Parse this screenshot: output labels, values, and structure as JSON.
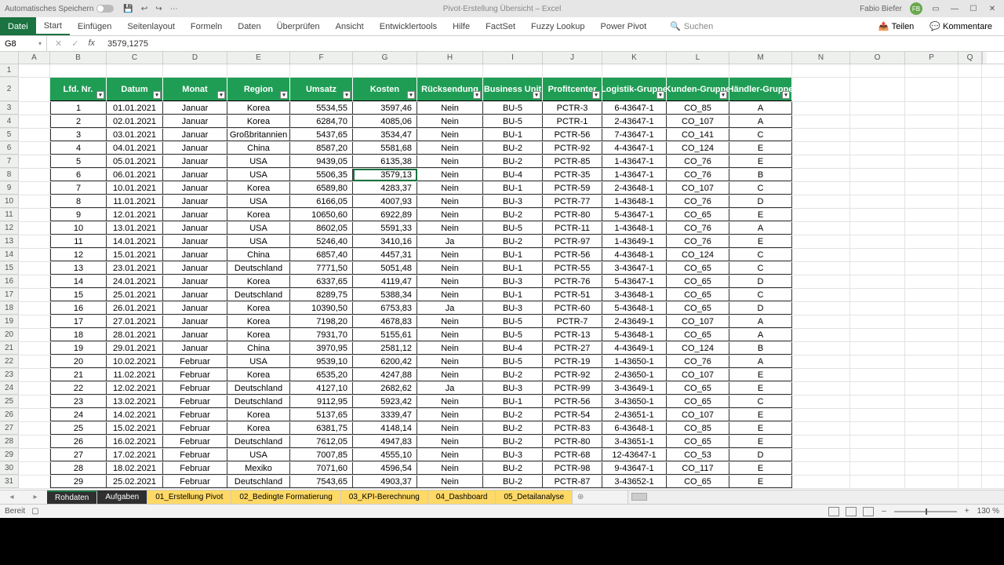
{
  "title": {
    "autosave": "Automatisches Speichern",
    "doc": "Pivot-Erstellung Übersicht",
    "app": "Excel",
    "user": "Fabio Biefer",
    "initials": "FB"
  },
  "ribbon_tabs": [
    "Datei",
    "Start",
    "Einfügen",
    "Seitenlayout",
    "Formeln",
    "Daten",
    "Überprüfen",
    "Ansicht",
    "Entwicklertools",
    "Hilfe",
    "FactSet",
    "Fuzzy Lookup",
    "Power Pivot"
  ],
  "search_placeholder": "Suchen",
  "share_label": "Teilen",
  "comments_label": "Kommentare",
  "namebox": "G8",
  "formula": "3579,1275",
  "columns": [
    "A",
    "B",
    "C",
    "D",
    "E",
    "F",
    "G",
    "H",
    "I",
    "J",
    "K",
    "L",
    "M",
    "N",
    "O",
    "P",
    "Q"
  ],
  "headers": [
    "Lfd. Nr.",
    "Datum",
    "Monat",
    "Region",
    "Umsatz",
    "Kosten",
    "Rücksendung",
    "Business Unit",
    "Profitcenter",
    "Logistik-Gruppe",
    "Kunden-Gruppe",
    "Händler-Gruppe"
  ],
  "rows": [
    [
      1,
      "01.01.2021",
      "Januar",
      "Korea",
      "5534,55",
      "3597,46",
      "Nein",
      "BU-5",
      "PCTR-3",
      "6-43647-1",
      "CO_85",
      "A"
    ],
    [
      2,
      "02.01.2021",
      "Januar",
      "Korea",
      "6284,70",
      "4085,06",
      "Nein",
      "BU-5",
      "PCTR-1",
      "2-43647-1",
      "CO_107",
      "A"
    ],
    [
      3,
      "03.01.2021",
      "Januar",
      "Großbritannien",
      "5437,65",
      "3534,47",
      "Nein",
      "BU-1",
      "PCTR-56",
      "7-43647-1",
      "CO_141",
      "C"
    ],
    [
      4,
      "04.01.2021",
      "Januar",
      "China",
      "8587,20",
      "5581,68",
      "Nein",
      "BU-2",
      "PCTR-92",
      "4-43647-1",
      "CO_124",
      "E"
    ],
    [
      5,
      "05.01.2021",
      "Januar",
      "USA",
      "9439,05",
      "6135,38",
      "Nein",
      "BU-2",
      "PCTR-85",
      "1-43647-1",
      "CO_76",
      "E"
    ],
    [
      6,
      "06.01.2021",
      "Januar",
      "USA",
      "5506,35",
      "3579,13",
      "Nein",
      "BU-4",
      "PCTR-35",
      "1-43647-1",
      "CO_76",
      "B"
    ],
    [
      7,
      "10.01.2021",
      "Januar",
      "Korea",
      "6589,80",
      "4283,37",
      "Nein",
      "BU-1",
      "PCTR-59",
      "2-43648-1",
      "CO_107",
      "C"
    ],
    [
      8,
      "11.01.2021",
      "Januar",
      "USA",
      "6166,05",
      "4007,93",
      "Nein",
      "BU-3",
      "PCTR-77",
      "1-43648-1",
      "CO_76",
      "D"
    ],
    [
      9,
      "12.01.2021",
      "Januar",
      "Korea",
      "10650,60",
      "6922,89",
      "Nein",
      "BU-2",
      "PCTR-80",
      "5-43647-1",
      "CO_65",
      "E"
    ],
    [
      10,
      "13.01.2021",
      "Januar",
      "USA",
      "8602,05",
      "5591,33",
      "Nein",
      "BU-5",
      "PCTR-11",
      "1-43648-1",
      "CO_76",
      "A"
    ],
    [
      11,
      "14.01.2021",
      "Januar",
      "USA",
      "5246,40",
      "3410,16",
      "Ja",
      "BU-2",
      "PCTR-97",
      "1-43649-1",
      "CO_76",
      "E"
    ],
    [
      12,
      "15.01.2021",
      "Januar",
      "China",
      "6857,40",
      "4457,31",
      "Nein",
      "BU-1",
      "PCTR-56",
      "4-43648-1",
      "CO_124",
      "C"
    ],
    [
      13,
      "23.01.2021",
      "Januar",
      "Deutschland",
      "7771,50",
      "5051,48",
      "Nein",
      "BU-1",
      "PCTR-55",
      "3-43647-1",
      "CO_65",
      "C"
    ],
    [
      14,
      "24.01.2021",
      "Januar",
      "Korea",
      "6337,65",
      "4119,47",
      "Nein",
      "BU-3",
      "PCTR-76",
      "5-43647-1",
      "CO_65",
      "D"
    ],
    [
      15,
      "25.01.2021",
      "Januar",
      "Deutschland",
      "8289,75",
      "5388,34",
      "Nein",
      "BU-1",
      "PCTR-51",
      "3-43648-1",
      "CO_65",
      "C"
    ],
    [
      16,
      "26.01.2021",
      "Januar",
      "Korea",
      "10390,50",
      "6753,83",
      "Ja",
      "BU-3",
      "PCTR-60",
      "5-43648-1",
      "CO_65",
      "D"
    ],
    [
      17,
      "27.01.2021",
      "Januar",
      "Korea",
      "7198,20",
      "4678,83",
      "Nein",
      "BU-5",
      "PCTR-7",
      "2-43649-1",
      "CO_107",
      "A"
    ],
    [
      18,
      "28.01.2021",
      "Januar",
      "Korea",
      "7931,70",
      "5155,61",
      "Nein",
      "BU-5",
      "PCTR-13",
      "5-43648-1",
      "CO_65",
      "A"
    ],
    [
      19,
      "29.01.2021",
      "Januar",
      "China",
      "3970,95",
      "2581,12",
      "Nein",
      "BU-4",
      "PCTR-27",
      "4-43649-1",
      "CO_124",
      "B"
    ],
    [
      20,
      "10.02.2021",
      "Februar",
      "USA",
      "9539,10",
      "6200,42",
      "Nein",
      "BU-5",
      "PCTR-19",
      "1-43650-1",
      "CO_76",
      "A"
    ],
    [
      21,
      "11.02.2021",
      "Februar",
      "Korea",
      "6535,20",
      "4247,88",
      "Nein",
      "BU-2",
      "PCTR-92",
      "2-43650-1",
      "CO_107",
      "E"
    ],
    [
      22,
      "12.02.2021",
      "Februar",
      "Deutschland",
      "4127,10",
      "2682,62",
      "Ja",
      "BU-3",
      "PCTR-99",
      "3-43649-1",
      "CO_65",
      "E"
    ],
    [
      23,
      "13.02.2021",
      "Februar",
      "Deutschland",
      "9112,95",
      "5923,42",
      "Nein",
      "BU-1",
      "PCTR-56",
      "3-43650-1",
      "CO_65",
      "C"
    ],
    [
      24,
      "14.02.2021",
      "Februar",
      "Korea",
      "5137,65",
      "3339,47",
      "Nein",
      "BU-2",
      "PCTR-54",
      "2-43651-1",
      "CO_107",
      "E"
    ],
    [
      25,
      "15.02.2021",
      "Februar",
      "Korea",
      "6381,75",
      "4148,14",
      "Nein",
      "BU-2",
      "PCTR-83",
      "6-43648-1",
      "CO_85",
      "E"
    ],
    [
      26,
      "16.02.2021",
      "Februar",
      "Deutschland",
      "7612,05",
      "4947,83",
      "Nein",
      "BU-2",
      "PCTR-80",
      "3-43651-1",
      "CO_65",
      "E"
    ],
    [
      27,
      "17.02.2021",
      "Februar",
      "USA",
      "7007,85",
      "4555,10",
      "Nein",
      "BU-3",
      "PCTR-68",
      "12-43647-1",
      "CO_53",
      "D"
    ],
    [
      28,
      "18.02.2021",
      "Februar",
      "Mexiko",
      "7071,60",
      "4596,54",
      "Nein",
      "BU-2",
      "PCTR-98",
      "9-43647-1",
      "CO_117",
      "E"
    ],
    [
      29,
      "25.02.2021",
      "Februar",
      "Deutschland",
      "7543,65",
      "4903,37",
      "Nein",
      "BU-2",
      "PCTR-87",
      "3-43652-1",
      "CO_65",
      "E"
    ]
  ],
  "sheets": [
    {
      "name": "Rohdaten",
      "cls": "dark active"
    },
    {
      "name": "Aufgaben",
      "cls": "dark"
    },
    {
      "name": "01_Erstellung Pivot",
      "cls": "yellow"
    },
    {
      "name": "02_Bedingte Formatierung",
      "cls": "yellow"
    },
    {
      "name": "03_KPI-Berechnung",
      "cls": "yellow"
    },
    {
      "name": "04_Dashboard",
      "cls": "yellow"
    },
    {
      "name": "05_Detailanalyse",
      "cls": "yellow"
    }
  ],
  "status": {
    "ready": "Bereit",
    "zoom": "130 %"
  },
  "selected": {
    "row": 6,
    "col": 5
  }
}
